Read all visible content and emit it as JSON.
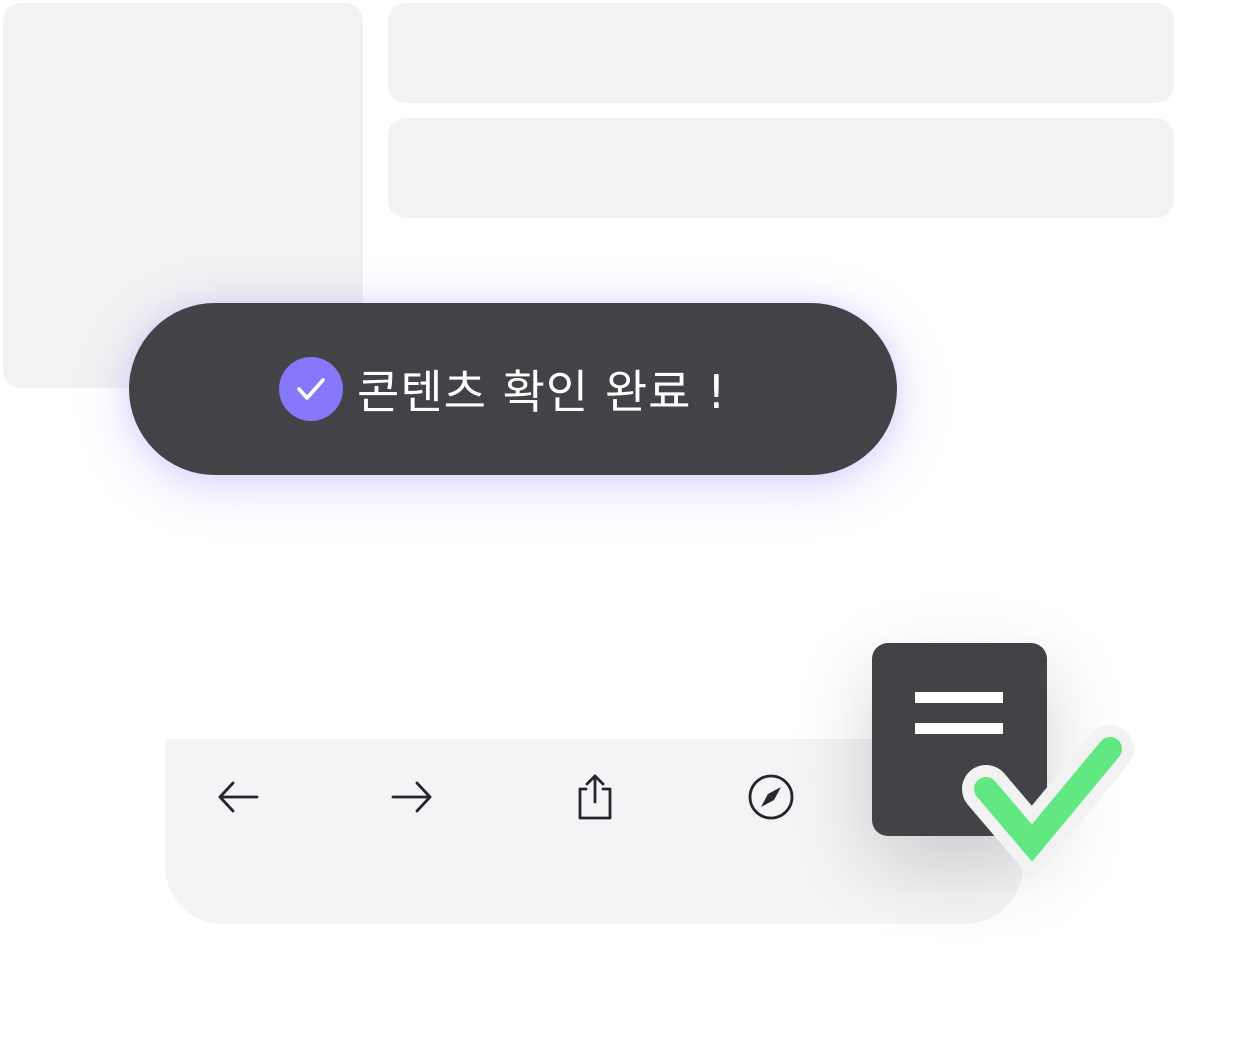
{
  "toast": {
    "message": "콘텐츠 확인 완료 !",
    "icon": "check-circle-icon",
    "icon_color": "#8677fb",
    "background_color": "#434347"
  },
  "toolbar": {
    "buttons": [
      {
        "icon": "arrow-left-icon"
      },
      {
        "icon": "arrow-right-icon"
      },
      {
        "icon": "share-icon"
      },
      {
        "icon": "compass-icon"
      }
    ]
  },
  "document_badge": {
    "icon": "document-check-icon",
    "check_color": "#62e882"
  }
}
